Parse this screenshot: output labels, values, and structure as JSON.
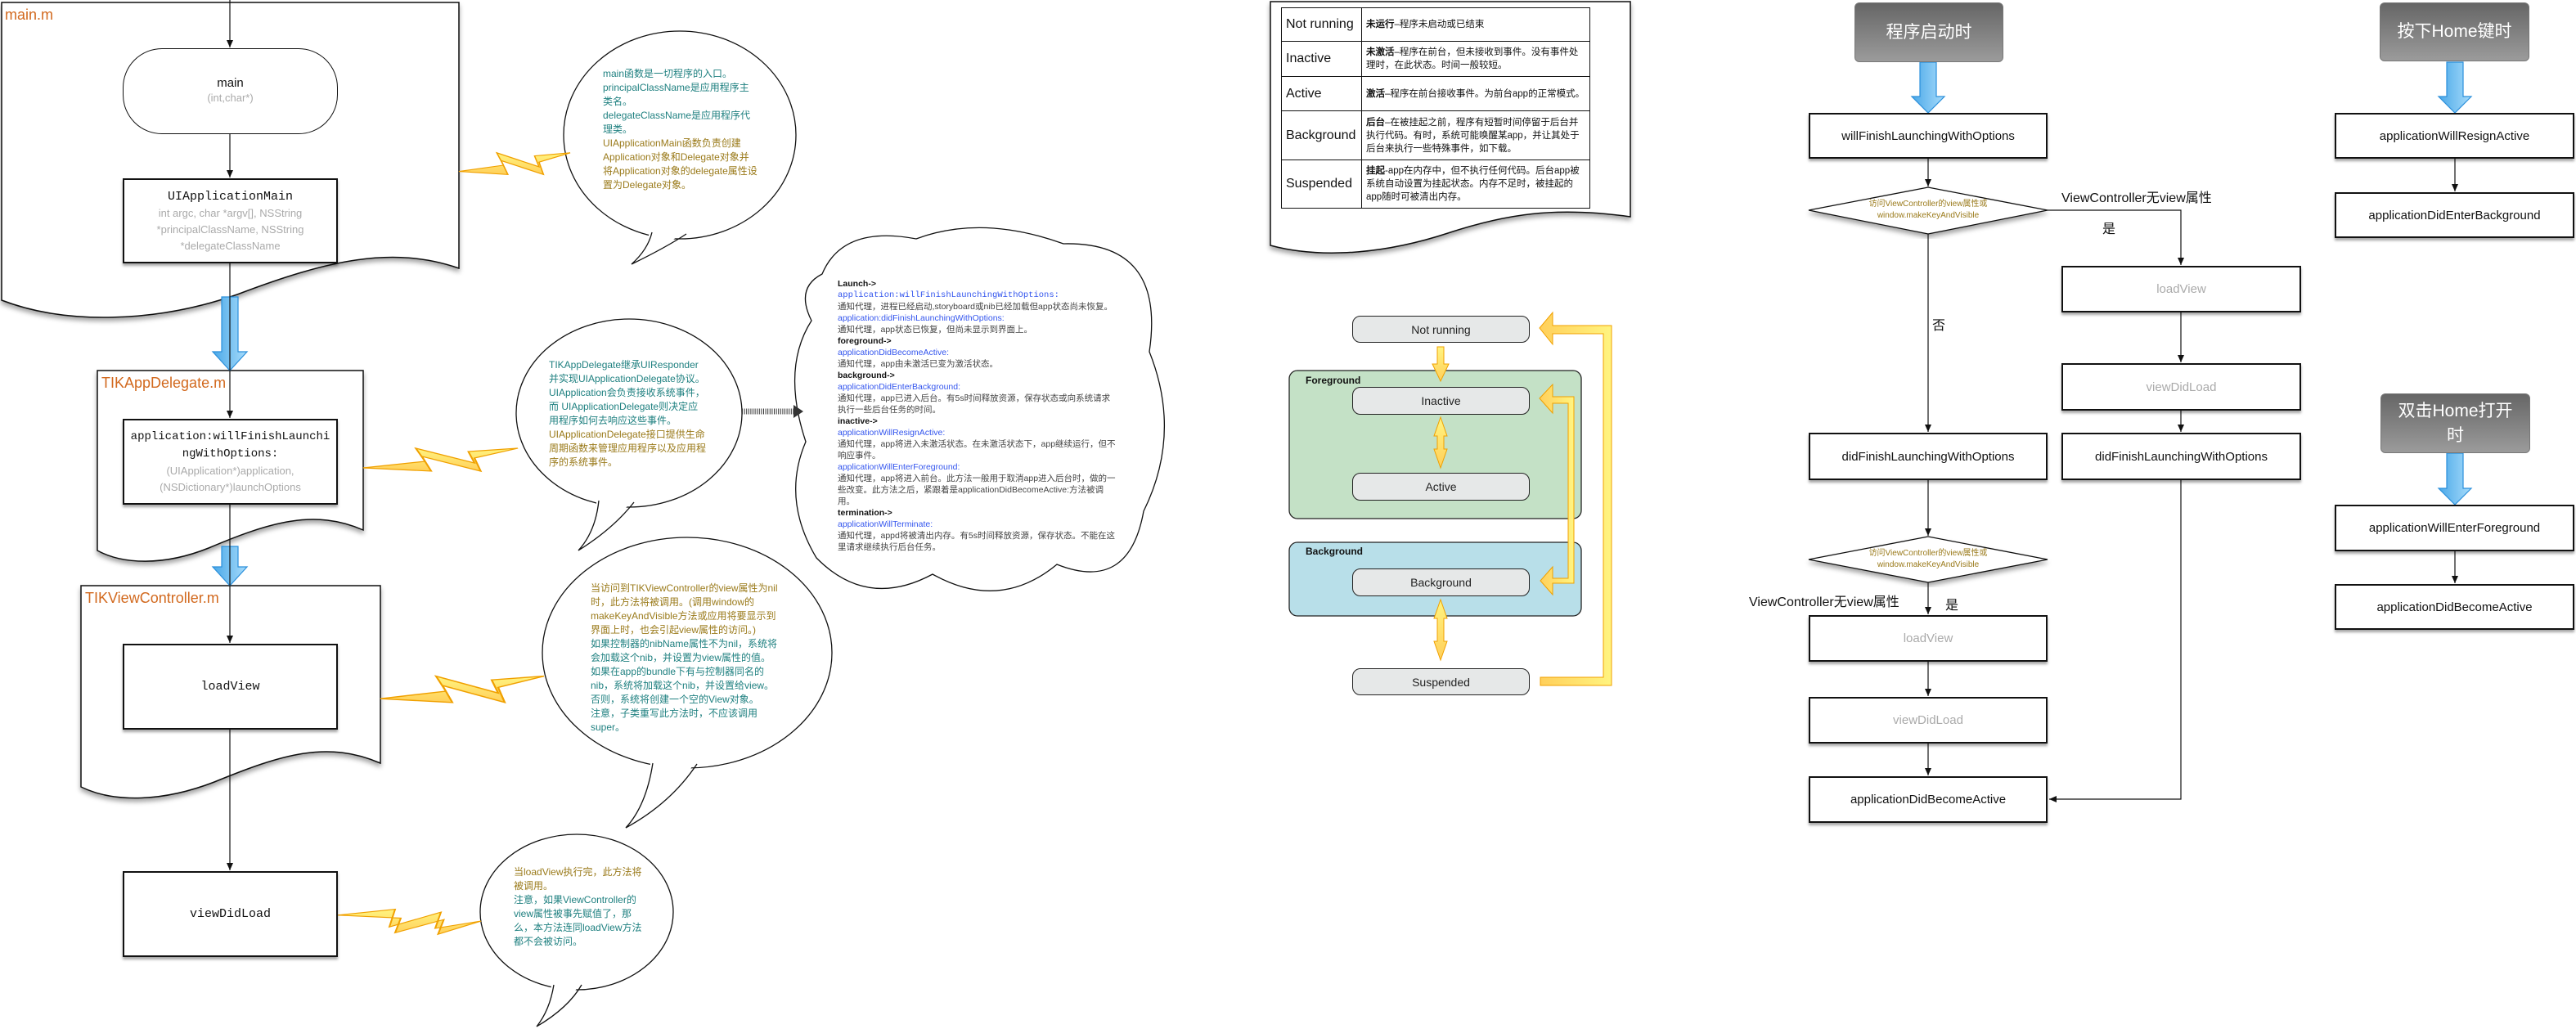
{
  "colors": {
    "doc_label": "#d2691e",
    "teal_text": "#1f8080",
    "gold_text": "#9a7a1a",
    "method_blue": "#3355ee",
    "foreground_group": "#c4e1c6",
    "background_group": "#b8dfe9",
    "state_box": "#e6e8e8",
    "blue_arrow": "#6cc0f2",
    "yellow_arrow": "#ffe070"
  },
  "main_m": {
    "label": "main.m",
    "main_box": {
      "title": "main",
      "params": "(int,char*)"
    },
    "uiapp_box": {
      "title": "UIApplicationMain",
      "params": "int argc, char *argv[], NSString *principalClassName, NSString *delegateClassName"
    }
  },
  "delegate_m": {
    "label": "TIKAppDelegate.m",
    "box": {
      "title": "application:willFinishLaunchingWithOptions:",
      "params": "(UIApplication*)application, (NSDictionary*)launchOptions"
    }
  },
  "viewcontroller_m": {
    "label": "TIKViewController.m",
    "loadview": "loadView",
    "viewdidload": "viewDidLoad"
  },
  "bubbles": {
    "main": [
      {
        "color": "teal",
        "text": "main函数是一切程序的入口。"
      },
      {
        "color": "teal",
        "text": "principalClassName是应用程序主类名。"
      },
      {
        "color": "teal",
        "text": "delegateClassName是应用程序代理类。"
      },
      {
        "color": "gold",
        "text": "UIApplicationMain函数负责创建Application对象和Delegate对象并将Application对象的delegate属性设置为Delegate对象。"
      }
    ],
    "delegate": [
      {
        "color": "teal",
        "text": "TIKAppDelegate继承UIResponder并实现UIApplicationDelegate协议。"
      },
      {
        "color": "teal",
        "text": "UIApplication会负责接收系统事件，而 UIApplicationDelegate则决定应用程序如何去响应这些事件。"
      },
      {
        "color": "gold",
        "text": "UIApplicationDelegate接口提供生命周期函数来管理应用程序以及应用程序的系统事件。"
      }
    ],
    "loadview": [
      {
        "color": "gold",
        "text": "当访问到TIKViewController的view属性为nil时，此方法将被调用。(调用window的makeKeyAndVisible方法或应用将要显示到界面上时，也会引起view属性的访问。)"
      },
      {
        "color": "teal",
        "text": "如果控制器的nibName属性不为nil，系统将会加载这个nib，并设置为view属性的值。"
      },
      {
        "color": "teal",
        "text": "如果在app的bundle下有与控制器同名的nib，系统将加载这个nib，并设置给view。"
      },
      {
        "color": "teal",
        "text": "否则，系统将创建一个空的View对象。"
      },
      {
        "color": "teal",
        "text": "注意，子类重写此方法时，不应该调用super。"
      }
    ],
    "viewdidload": [
      {
        "color": "gold",
        "text": "当loadView执行完，此方法将被调用。"
      },
      {
        "color": "teal",
        "text": "注意，如果ViewController的view属性被事先赋值了，那么，本方法连同loadView方法都不会被访问。"
      }
    ]
  },
  "cloud": {
    "items": [
      {
        "kind": "heading",
        "text": "Launch->"
      },
      {
        "kind": "method",
        "text": "application:willFinishLaunchingWithOptions:"
      },
      {
        "kind": "desc",
        "text": "通知代理，进程已经启动,storyboard或nib已经加载但app状态尚未恢复。"
      },
      {
        "kind": "method",
        "text": "application:didFinishLaunchingWithOptions:"
      },
      {
        "kind": "desc",
        "text": "通知代理，app状态已恢复，但尚未显示到界面上。"
      },
      {
        "kind": "heading",
        "text": "foreground->"
      },
      {
        "kind": "method",
        "text": "applicationDidBecomeActive:"
      },
      {
        "kind": "desc",
        "text": "通知代理，app由未激活已变为激活状态。"
      },
      {
        "kind": "heading",
        "text": "background->"
      },
      {
        "kind": "method",
        "text": "applicationDidEnterBackground:"
      },
      {
        "kind": "desc",
        "text": "通知代理，app已进入后台。有5s时间释放资源，保存状态或向系统请求执行一些后台任务的时间。"
      },
      {
        "kind": "heading",
        "text": "inactive->"
      },
      {
        "kind": "method",
        "text": "applicationWillResignActive:"
      },
      {
        "kind": "desc",
        "text": "通知代理，app将进入未激活状态。在未激活状态下，app继续运行，但不响应事件。"
      },
      {
        "kind": "method",
        "text": "applicationWillEnterForeground:"
      },
      {
        "kind": "desc",
        "text": "通知代理，app将进入前台。此方法一般用于取消app进入后台时，做的一些改变。此方法之后，紧跟着是applicationDidBecomeActive:方法被调用。"
      },
      {
        "kind": "heading",
        "text": "termination->"
      },
      {
        "kind": "method",
        "text": "applicationWillTerminate:"
      },
      {
        "kind": "desc",
        "text": "通知代理，appd将被清出内存。有5s时间释放资源，保存状态。不能在这里请求继续执行后台任务。"
      }
    ]
  },
  "state_table": [
    {
      "state": "Not running",
      "bold": "未运行",
      "desc": "–程序未启动或已结束"
    },
    {
      "state": "Inactive",
      "bold": "未激活",
      "desc": "–程序在前台，但未接收到事件。没有事件处理时，在此状态。时间一般较短。"
    },
    {
      "state": "Active",
      "bold": "激活",
      "desc": "–程序在前台接收事件。为前台app的正常模式。"
    },
    {
      "state": "Background",
      "bold": "后台",
      "desc": "–在被挂起之前，程序有短暂时间停留于后台并执行代码。有时，系统可能唤醒某app，并让其处于后台来执行一些特殊事件，如下载。"
    },
    {
      "state": "Suspended",
      "bold": "挂起",
      "desc": "-app在内存中，但不执行任何代码。后台app被系统自动设置为挂起状态。内存不足时，被挂起的app随时可被清出内存。"
    }
  ],
  "state_diagram": {
    "not_running": "Not running",
    "foreground_group": "Foreground",
    "inactive": "Inactive",
    "active": "Active",
    "background_group": "Background",
    "background": "Background",
    "suspended": "Suspended"
  },
  "launch_flow": {
    "header": "程序启动时",
    "will_finish": "willFinishLaunchingWithOptions",
    "decision": "访问ViewController的view属性或window.makeKeyAndVisible",
    "decision_line1": "访问ViewController的view属性或",
    "decision_line2": "window.makeKeyAndVisible",
    "no_view_label": "ViewController无view属性",
    "yes_label": "是",
    "no_label": "否",
    "branch_yes": {
      "load_view": "loadView",
      "view_did_load": "viewDidLoad",
      "did_finish": "didFinishLaunchingWithOptions"
    },
    "branch_no": {
      "did_finish": "didFinishLaunchingWithOptions"
    },
    "decision2_line1": "访问ViewController的view属性或",
    "decision2_line2": "window.makeKeyAndVisible",
    "no_view_label2": "ViewController无view属性",
    "yes_label2": "是",
    "load_view": "loadView",
    "view_did_load": "viewDidLoad",
    "did_become_active": "applicationDidBecomeActive"
  },
  "home_flow": {
    "header": "按下Home键时",
    "will_resign": "applicationWillResignActive",
    "did_enter_background": "applicationDidEnterBackground"
  },
  "reopen_flow": {
    "header": "双击Home打开时",
    "will_enter_foreground": "applicationWillEnterForeground",
    "did_become_active": "applicationDidBecomeActive"
  }
}
